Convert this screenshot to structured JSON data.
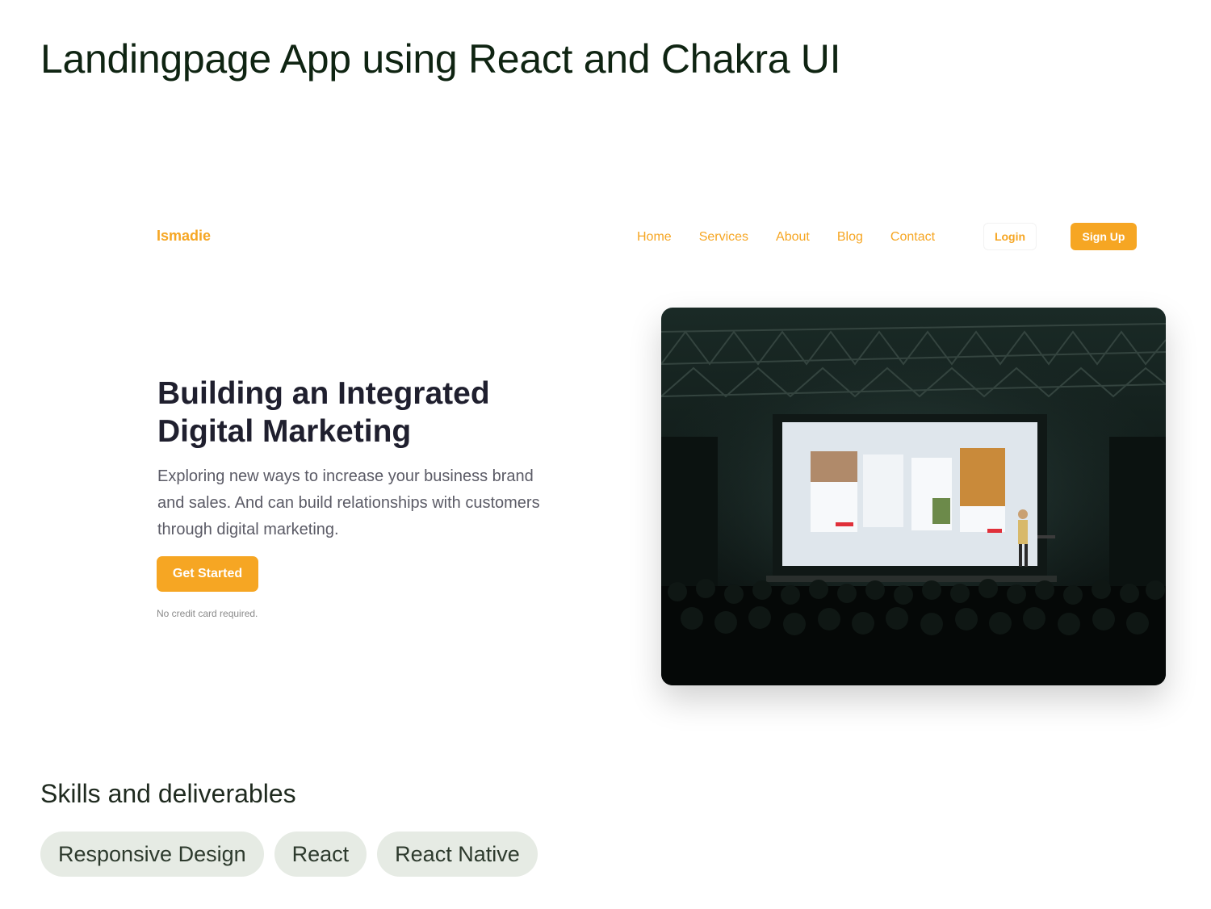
{
  "project": {
    "title": "Landingpage App using React and Chakra UI"
  },
  "landing": {
    "brand": "Ismadie",
    "nav": [
      "Home",
      "Services",
      "About",
      "Blog",
      "Contact"
    ],
    "login_label": "Login",
    "signup_label": "Sign Up",
    "hero": {
      "heading": "Building an Integrated Digital Marketing",
      "text": "Exploring new ways to increase your business brand and sales. And can build relationships with customers through digital marketing.",
      "cta_label": "Get Started",
      "fineprint": "No credit card required."
    }
  },
  "skills": {
    "title": "Skills and deliverables",
    "items": [
      "Responsive Design",
      "React",
      "React Native"
    ]
  },
  "colors": {
    "accent": "#f6a623",
    "chip_bg": "#e6ebe4"
  }
}
